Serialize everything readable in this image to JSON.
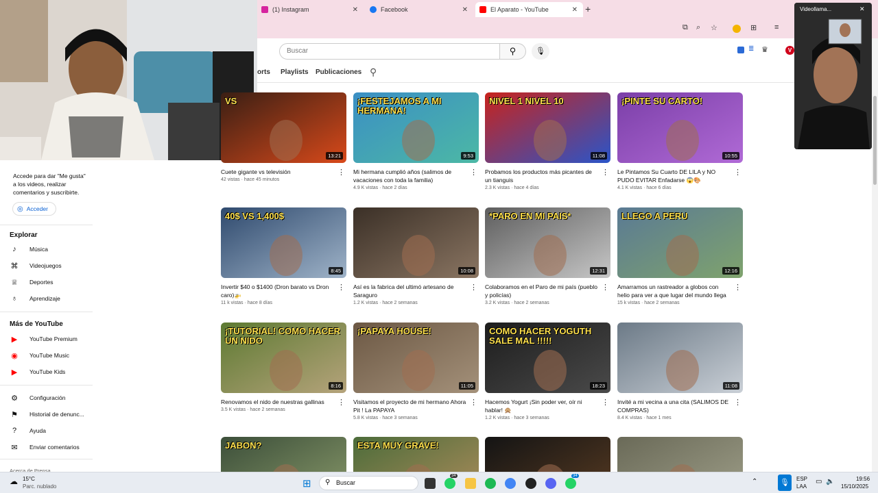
{
  "browser": {
    "tabs": [
      {
        "label": "(1) Instagram",
        "color": "#d6249f"
      },
      {
        "label": "Facebook",
        "color": "#1877f2"
      },
      {
        "label": "El Aparato - YouTube",
        "color": "#ff0000"
      }
    ]
  },
  "youtube": {
    "search_placeholder": "Buscar",
    "channel_tabs": [
      "orts",
      "Playlists",
      "Publicaciones"
    ],
    "avatar_letter": "V"
  },
  "sidebar": {
    "signin_text": "Accede para dar \"Me gusta\" a los videos, realizar comentarios y suscribirte.",
    "signin_button": "Acceder",
    "explore_heading": "Explorar",
    "explore": [
      {
        "label": "Música",
        "icon": "music-icon"
      },
      {
        "label": "Videojuegos",
        "icon": "gamepad-icon"
      },
      {
        "label": "Deportes",
        "icon": "trophy-icon"
      },
      {
        "label": "Aprendizaje",
        "icon": "lightbulb-icon"
      }
    ],
    "more_heading": "Más de YouTube",
    "more": [
      {
        "label": "YouTube Premium",
        "icon": "yt-premium-icon"
      },
      {
        "label": "YouTube Music",
        "icon": "yt-music-icon"
      },
      {
        "label": "YouTube Kids",
        "icon": "yt-kids-icon"
      }
    ],
    "settings": [
      {
        "label": "Configuración",
        "icon": "gear-icon"
      },
      {
        "label": "Historial de denunc...",
        "icon": "flag-icon"
      },
      {
        "label": "Ayuda",
        "icon": "help-icon"
      },
      {
        "label": "Enviar comentarios",
        "icon": "feedback-icon"
      }
    ],
    "footer_partial": "Acerca de  Prensa"
  },
  "videos": [
    {
      "title": "Cuete gigante vs televisión",
      "meta": "42 vistas · hace 45 minutos",
      "duration": "13:21",
      "overlay": "VS",
      "bg": "#3a1f14",
      "bg2": "#d8491a"
    },
    {
      "title": "Mi hermana cumplió años (salimos de vacaciones con toda la familia)",
      "meta": "4.9 K vistas · hace 2 días",
      "duration": "9:53",
      "overlay": "¡FESTEJAMOS A MI HERMANA!",
      "bg": "#3b8fc4",
      "bg2": "#4cb8a5"
    },
    {
      "title": "Probamos los productos más picantes de un tianguis",
      "meta": "2.3 K vistas · hace 4 días",
      "duration": "11:08",
      "overlay": "NIVEL 1   NIVEL 10",
      "bg": "#c8231c",
      "bg2": "#2a55c9"
    },
    {
      "title": "Le Pintamos Su Cuarto DE LILA y NO PUDO EVITAR Enfadarse 😱🎨",
      "meta": "4.1 K vistas · hace 6 días",
      "duration": "10:55",
      "overlay": "¡PINTE SU CARTO!",
      "bg": "#7b3fa8",
      "bg2": "#b06ad6"
    },
    {
      "title": "Invertir $40 o $1400 (Dron barato vs Dron caro)🚁",
      "meta": "11 k vistas · hace 8 días",
      "duration": "8:45",
      "overlay": "40$  VS 1,400$",
      "bg": "#2f4a6e",
      "bg2": "#9fb3c8"
    },
    {
      "title": "Así es la fabrica del ultimó artesano de Saraguro",
      "meta": "1.2 K vistas · hace 2 semanas",
      "duration": "10:08",
      "overlay": "",
      "bg": "#3b3027",
      "bg2": "#8a7562"
    },
    {
      "title": "Colaboramos en el Paro de mi país (pueblo y policías)",
      "meta": "3.2 K vistas · hace 2 semanas",
      "duration": "12:31",
      "overlay": "*PARO EN MI PAIS*",
      "bg": "#5e5e5e",
      "bg2": "#c7c7c7"
    },
    {
      "title": "Amarramos un rastreador a globos con helio para ver a que lugar del mundo llega",
      "meta": "15 k vistas · hace 2 semanas",
      "duration": "12:16",
      "overlay": "LLEGO A PERU",
      "bg": "#5a7a94",
      "bg2": "#7fa36d"
    },
    {
      "title": "Renovamos el nido de nuestras gallinas",
      "meta": "3.5 K vistas · hace 2 semanas",
      "duration": "8:16",
      "overlay": "¡TUTORIAL! COMO HACER UN NIDO",
      "bg": "#5d7a32",
      "bg2": "#b5a37b"
    },
    {
      "title": "Visitamos el proyecto de mi hermano Ahora Pit ! La PAPAYA",
      "meta": "5.8 K vistas · hace 3 semanas",
      "duration": "11:05",
      "overlay": "¡PAPAYA HOUSE!",
      "bg": "#6c5844",
      "bg2": "#a4917a"
    },
    {
      "title": "Hacemos Yogurt ¡Sin poder ver, oír ni hablar! 🙊",
      "meta": "1.2 K vistas · hace 3 semanas",
      "duration": "18:23",
      "overlay": "COMO HACER YOGUTH SALE MAL !!!!!",
      "bg": "#1d1d1d",
      "bg2": "#4a4a4a"
    },
    {
      "title": "Invité a mi vecina a una cita (SALIMOS DE COMPRAS)",
      "meta": "8.4 K vistas · hace 1 mes",
      "duration": "11:08",
      "overlay": "",
      "bg": "#6c7a87",
      "bg2": "#c9cfd6"
    },
    {
      "title": "",
      "meta": "",
      "duration": "",
      "overlay": "JABON?",
      "bg": "#3c4f3a",
      "bg2": "#8a9a6a"
    },
    {
      "title": "",
      "meta": "",
      "duration": "",
      "overlay": "ESTA MUY GRAVE!",
      "bg": "#4c6c3a",
      "bg2": "#b08d5c"
    },
    {
      "title": "",
      "meta": "",
      "duration": "",
      "overlay": "",
      "bg": "#141414",
      "bg2": "#5a3c22"
    },
    {
      "title": "",
      "meta": "",
      "duration": "",
      "overlay": "",
      "bg": "#6a6a58",
      "bg2": "#a0a08a"
    }
  ],
  "video_call": {
    "title": "Videollama...",
    "close": "✕"
  },
  "taskbar": {
    "weather_temp": "15°C",
    "weather_desc": "Parc. nublado",
    "search_label": "Buscar",
    "lang": "ESP",
    "region": "LAA",
    "time": "19:56",
    "date": "15/10/2025",
    "badge_count": "34"
  }
}
